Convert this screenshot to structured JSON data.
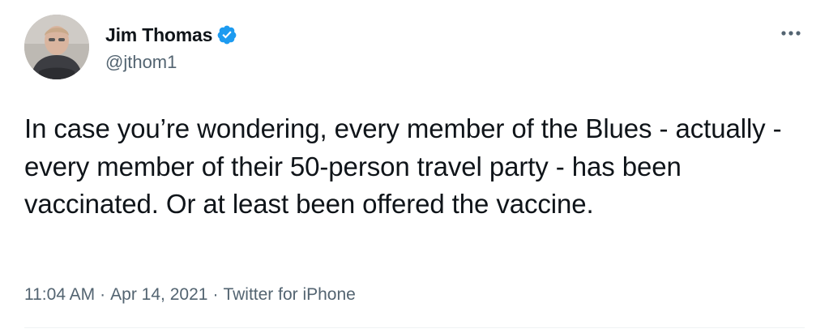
{
  "user": {
    "display_name": "Jim Thomas",
    "handle": "@jthom1",
    "verified": true,
    "avatar_icon": "profile-photo"
  },
  "tweet": {
    "text": "In case you’re wondering, every member of the Blues - actually - every member of their 50-person travel party - has been vaccinated. Or at least been offered the vaccine."
  },
  "meta": {
    "time": "11:04 AM",
    "date": "Apr 14, 2021",
    "source": "Twitter for iPhone",
    "separator": "·"
  },
  "icons": {
    "more": "more-horizontal-icon",
    "verified": "verified-badge-icon"
  },
  "colors": {
    "text": "#0f1419",
    "secondary": "#536471",
    "verified_blue": "#1d9bf0",
    "background": "#ffffff"
  }
}
